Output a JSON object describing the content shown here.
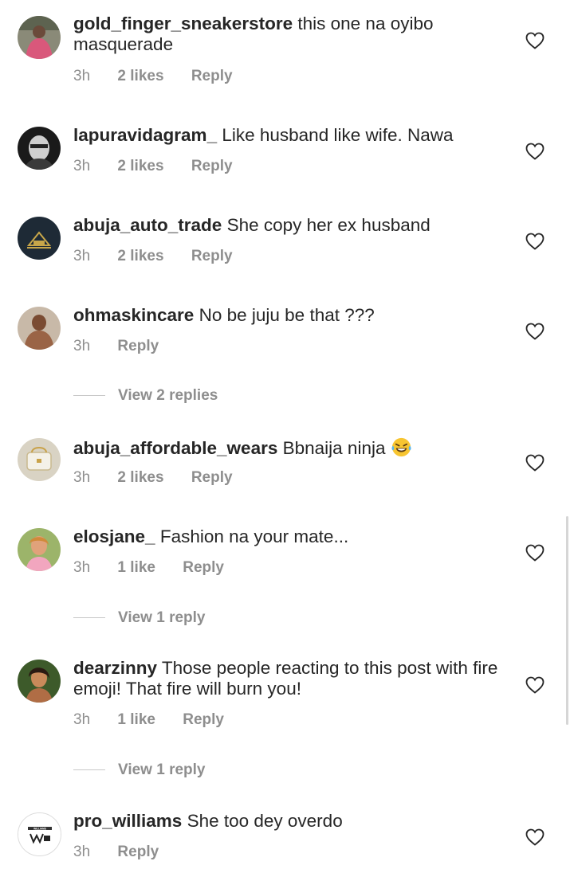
{
  "comments": [
    {
      "username": "gold_finger_sneakerstore",
      "text": "this one na oyibo masquerade",
      "time": "3h",
      "likes": "2 likes",
      "reply": "Reply"
    },
    {
      "username": "lapuravidagram_",
      "text": "Like husband like wife. Nawa",
      "time": "3h",
      "likes": "2 likes",
      "reply": "Reply"
    },
    {
      "username": "abuja_auto_trade",
      "text": "She copy her ex husband",
      "time": "3h",
      "likes": "2 likes",
      "reply": "Reply"
    },
    {
      "username": "ohmaskincare",
      "text": "No be juju be that ???",
      "time": "3h",
      "likes": "",
      "reply": "Reply",
      "view_replies": "View 2 replies"
    },
    {
      "username": "abuja_affordable_wears",
      "text": "Bbnaija ninja",
      "emoji": "face-with-tears-of-joy",
      "time": "3h",
      "likes": "2 likes",
      "reply": "Reply"
    },
    {
      "username": "elosjane_",
      "text": "Fashion na your mate...",
      "time": "3h",
      "likes": "1 like",
      "reply": "Reply",
      "view_replies": "View 1 reply"
    },
    {
      "username": "dearzinny",
      "text": "Those people reacting to this post with fire emoji! That fire will burn you!",
      "time": "3h",
      "likes": "1 like",
      "reply": "Reply",
      "view_replies": "View 1 reply"
    },
    {
      "username": "pro_williams",
      "text": "She too dey overdo",
      "time": "3h",
      "likes": "",
      "reply": "Reply",
      "avatar_logo": "WILLIAMS"
    }
  ],
  "colors": {
    "text": "#262626",
    "meta": "#8e8e8e",
    "divider": "#c7c7c7"
  },
  "icons": {
    "like": "heart-outline-icon"
  }
}
